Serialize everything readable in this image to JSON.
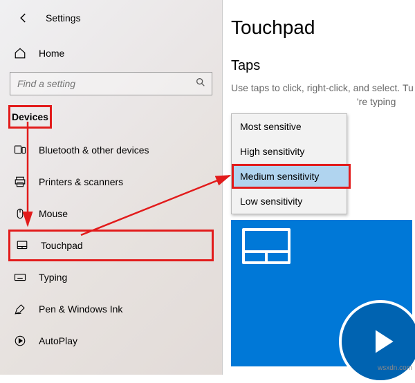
{
  "app": {
    "title": "Settings"
  },
  "home": {
    "label": "Home"
  },
  "search": {
    "placeholder": "Find a setting"
  },
  "section": {
    "heading": "Devices"
  },
  "nav": {
    "bluetooth": "Bluetooth & other devices",
    "printers": "Printers & scanners",
    "mouse": "Mouse",
    "touchpad": "Touchpad",
    "typing": "Typing",
    "pen": "Pen & Windows Ink",
    "autoplay": "AutoPlay"
  },
  "right": {
    "title": "Touchpad",
    "section": "Taps",
    "desc1": "Use taps to click, right-click, and select. Tu",
    "desc2": "'re typing"
  },
  "dropdown": {
    "most": "Most sensitive",
    "high": "High sensitivity",
    "medium": "Medium sensitivity",
    "low": "Low sensitivity"
  },
  "watermark": "wsxdn.com"
}
